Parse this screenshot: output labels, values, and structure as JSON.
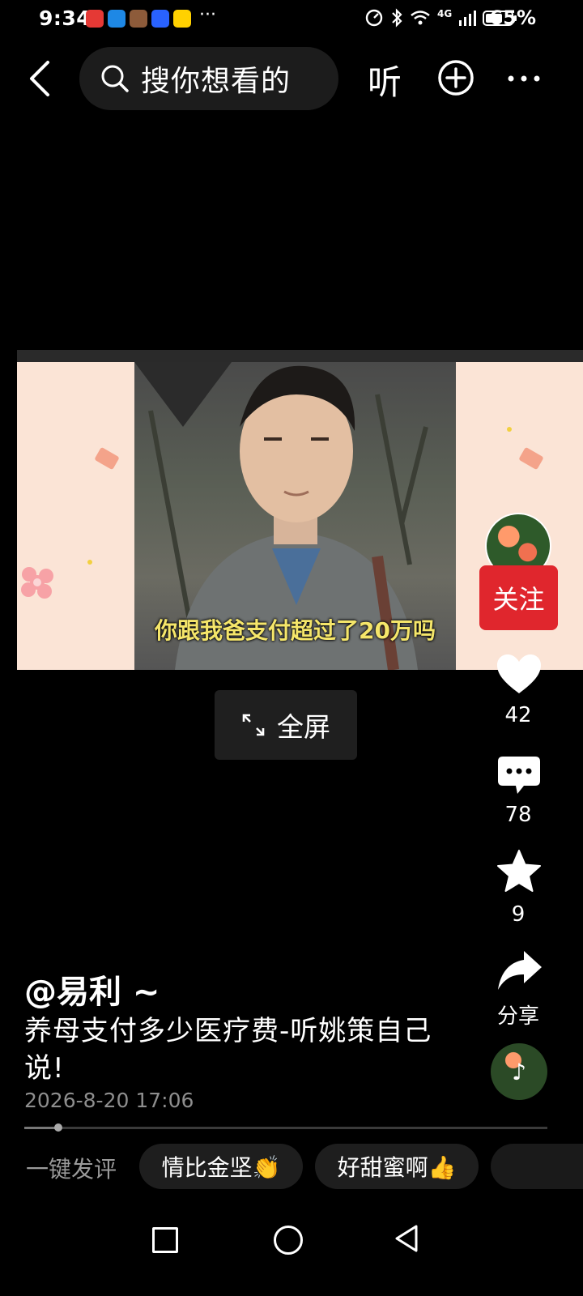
{
  "status_bar": {
    "time": "9:34",
    "more": "···",
    "network": "4G",
    "battery_percent": "65%",
    "battery_level": 0.65
  },
  "top_bar": {
    "search_placeholder": "搜你想看的",
    "listen_label": "听"
  },
  "video": {
    "subtitle": "你跟我爸支付超过了20万吗"
  },
  "fullscreen_label": "全屏",
  "sidebar": {
    "follow_label": "关注",
    "like_count": "42",
    "comment_count": "78",
    "favorite_count": "9",
    "share_label": "分享"
  },
  "post": {
    "author": "@易利 ~",
    "caption": "养母支付多少医疗费-听姚策自己说!",
    "date": "2026-8-20 17:06",
    "progress": 0.065
  },
  "quick_comment": {
    "label": "一键发评",
    "chips": [
      "情比金坚👏",
      "好甜蜜啊👍"
    ]
  },
  "colors": {
    "follow_red": "#e0262d",
    "subtitle_yellow": "#f5e66a",
    "background": "#000000"
  }
}
